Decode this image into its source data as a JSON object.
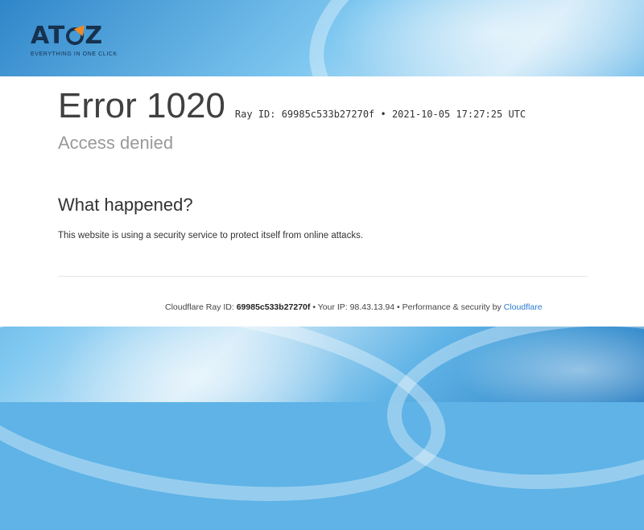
{
  "logo": {
    "brand": "ATOZ",
    "brand_left": "AT",
    "brand_right": "Z",
    "tagline": "EVERYTHING IN ONE CLICK"
  },
  "error": {
    "title": "Error 1020",
    "ray_line": "Ray ID: 69985c533b27270f • 2021-10-05 17:27:25 UTC",
    "subtitle": "Access denied"
  },
  "what_happened": {
    "heading": "What happened?",
    "text": "This website is using a security service to protect itself from online attacks."
  },
  "footer": {
    "ray_label": "Cloudflare Ray ID:",
    "ray_id": "69985c533b27270f",
    "sep1": "•",
    "ip_label": "Your IP:",
    "ip": "98.43.13.94",
    "sep2": "•",
    "perf_text": "Performance & security by",
    "cloudflare_link": "Cloudflare"
  },
  "colors": {
    "background": "#5fb3e6",
    "logo": "#16324f",
    "logo_accent": "#f08a24",
    "link": "#2c7cd1"
  }
}
